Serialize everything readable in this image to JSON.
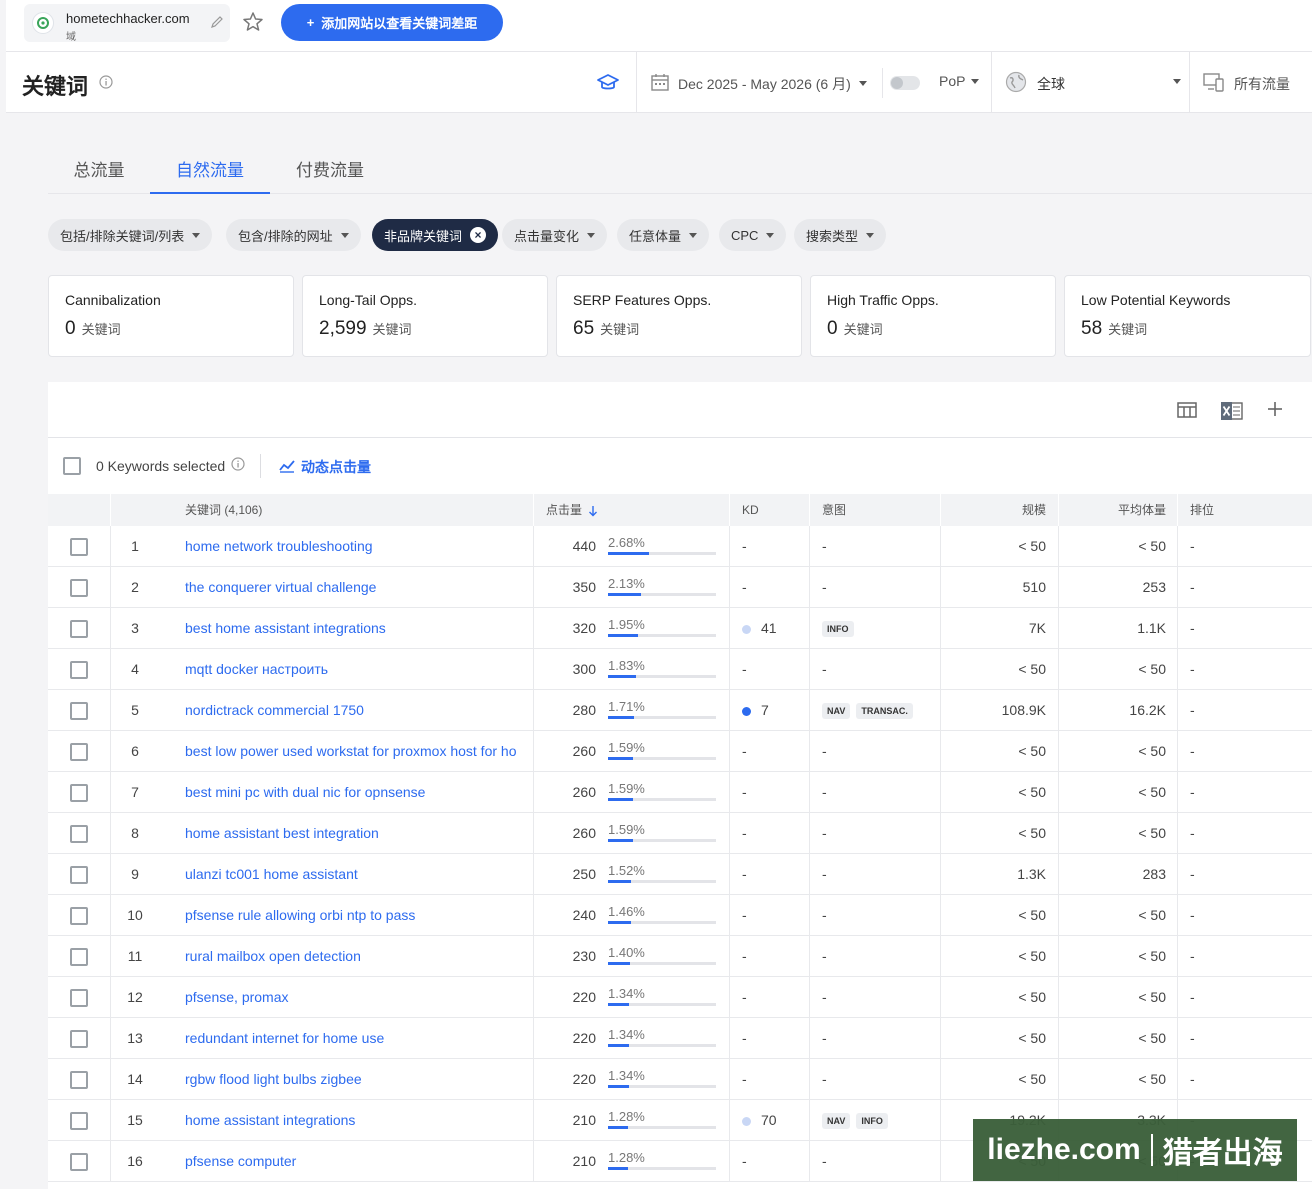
{
  "topbar": {
    "domain": "hometechhacker.com",
    "domain_type": "域",
    "add_site_button": "添加网站以查看关键词差距",
    "accent_color": "#2d6bef"
  },
  "header": {
    "title": "关键词",
    "date_range": "Dec 2025 - May 2026 (6 月)",
    "pop": "PoP",
    "region": "全球",
    "traffic": "所有流量"
  },
  "tabs": [
    {
      "label": "总流量"
    },
    {
      "label": "自然流量"
    },
    {
      "label": "付费流量"
    }
  ],
  "filters": [
    {
      "label": "包括/排除关键词/列表"
    },
    {
      "label": "包含/排除的网址"
    },
    {
      "label": "非品牌关键词"
    },
    {
      "label": "点击量变化"
    },
    {
      "label": "任意体量"
    },
    {
      "label": "CPC"
    },
    {
      "label": "搜索类型"
    }
  ],
  "cards": [
    {
      "title": "Cannibalization",
      "value": "0",
      "unit": "关键词"
    },
    {
      "title": "Long-Tail Opps.",
      "value": "2,599",
      "unit": "关键词"
    },
    {
      "title": "SERP Features Opps.",
      "value": "65",
      "unit": "关键词"
    },
    {
      "title": "High Traffic Opps.",
      "value": "0",
      "unit": "关键词"
    },
    {
      "title": "Low Potential Keywords",
      "value": "58",
      "unit": "关键词"
    }
  ],
  "table": {
    "selected_text": "0 Keywords selected",
    "dynamic_clicks": "动态点击量",
    "headers": {
      "keyword": "关键词 (4,106)",
      "clicks": "点击量",
      "kd": "KD",
      "intent": "意图",
      "scale": "规模",
      "avg_volume": "平均体量",
      "rank": "排位"
    },
    "rows": [
      {
        "n": "1",
        "keyword": "home network troubleshooting",
        "clicks": "440",
        "share": "2.68%",
        "share_frac": 0.0268,
        "kd": "-",
        "kd_color": "",
        "intents": [],
        "scale": "< 50",
        "avg": "< 50",
        "rank": "-"
      },
      {
        "n": "2",
        "keyword": "the conquerer virtual challenge",
        "clicks": "350",
        "share": "2.13%",
        "share_frac": 0.0213,
        "kd": "-",
        "kd_color": "",
        "intents": [],
        "scale": "510",
        "avg": "253",
        "rank": "-"
      },
      {
        "n": "3",
        "keyword": "best home assistant integrations",
        "clicks": "320",
        "share": "1.95%",
        "share_frac": 0.0195,
        "kd": "41",
        "kd_color": "#c9d7f5",
        "intents": [
          "INFO"
        ],
        "scale": "7K",
        "avg": "1.1K",
        "rank": "-"
      },
      {
        "n": "4",
        "keyword": "mqtt docker настроить",
        "clicks": "300",
        "share": "1.83%",
        "share_frac": 0.0183,
        "kd": "-",
        "kd_color": "",
        "intents": [],
        "scale": "< 50",
        "avg": "< 50",
        "rank": "-"
      },
      {
        "n": "5",
        "keyword": "nordictrack commercial 1750",
        "clicks": "280",
        "share": "1.71%",
        "share_frac": 0.0171,
        "kd": "7",
        "kd_color": "#2d6bef",
        "intents": [
          "NAV",
          "TRANSAC."
        ],
        "scale": "108.9K",
        "avg": "16.2K",
        "rank": "-"
      },
      {
        "n": "6",
        "keyword": "best low power used workstat for proxmox host for ho",
        "clicks": "260",
        "share": "1.59%",
        "share_frac": 0.0159,
        "kd": "-",
        "kd_color": "",
        "intents": [],
        "scale": "< 50",
        "avg": "< 50",
        "rank": "-"
      },
      {
        "n": "7",
        "keyword": "best mini pc with dual nic for opnsense",
        "clicks": "260",
        "share": "1.59%",
        "share_frac": 0.0159,
        "kd": "-",
        "kd_color": "",
        "intents": [],
        "scale": "< 50",
        "avg": "< 50",
        "rank": "-"
      },
      {
        "n": "8",
        "keyword": "home assistant best integration",
        "clicks": "260",
        "share": "1.59%",
        "share_frac": 0.0159,
        "kd": "-",
        "kd_color": "",
        "intents": [],
        "scale": "< 50",
        "avg": "< 50",
        "rank": "-"
      },
      {
        "n": "9",
        "keyword": "ulanzi tc001 home assistant",
        "clicks": "250",
        "share": "1.52%",
        "share_frac": 0.0152,
        "kd": "-",
        "kd_color": "",
        "intents": [],
        "scale": "1.3K",
        "avg": "283",
        "rank": "-"
      },
      {
        "n": "10",
        "keyword": "pfsense rule allowing orbi ntp to pass",
        "clicks": "240",
        "share": "1.46%",
        "share_frac": 0.0146,
        "kd": "-",
        "kd_color": "",
        "intents": [],
        "scale": "< 50",
        "avg": "< 50",
        "rank": "-"
      },
      {
        "n": "11",
        "keyword": "rural mailbox open detection",
        "clicks": "230",
        "share": "1.40%",
        "share_frac": 0.014,
        "kd": "-",
        "kd_color": "",
        "intents": [],
        "scale": "< 50",
        "avg": "< 50",
        "rank": "-"
      },
      {
        "n": "12",
        "keyword": "pfsense, promax",
        "clicks": "220",
        "share": "1.34%",
        "share_frac": 0.0134,
        "kd": "-",
        "kd_color": "",
        "intents": [],
        "scale": "< 50",
        "avg": "< 50",
        "rank": "-"
      },
      {
        "n": "13",
        "keyword": "redundant internet for home use",
        "clicks": "220",
        "share": "1.34%",
        "share_frac": 0.0134,
        "kd": "-",
        "kd_color": "",
        "intents": [],
        "scale": "< 50",
        "avg": "< 50",
        "rank": "-"
      },
      {
        "n": "14",
        "keyword": "rgbw flood light bulbs zigbee",
        "clicks": "220",
        "share": "1.34%",
        "share_frac": 0.0134,
        "kd": "-",
        "kd_color": "",
        "intents": [],
        "scale": "< 50",
        "avg": "< 50",
        "rank": "-"
      },
      {
        "n": "15",
        "keyword": "home assistant integrations",
        "clicks": "210",
        "share": "1.28%",
        "share_frac": 0.0128,
        "kd": "70",
        "kd_color": "#c9d7f5",
        "intents": [
          "NAV",
          "INFO"
        ],
        "scale": "19.2K",
        "avg": "3.3K",
        "rank": "-"
      },
      {
        "n": "16",
        "keyword": "pfsense computer",
        "clicks": "210",
        "share": "1.28%",
        "share_frac": 0.0128,
        "kd": "-",
        "kd_color": "",
        "intents": [],
        "scale": "< 50",
        "avg": "< 50",
        "rank": "-"
      }
    ]
  },
  "watermark": {
    "left": "liezhe.com",
    "right": "猎者出海"
  }
}
